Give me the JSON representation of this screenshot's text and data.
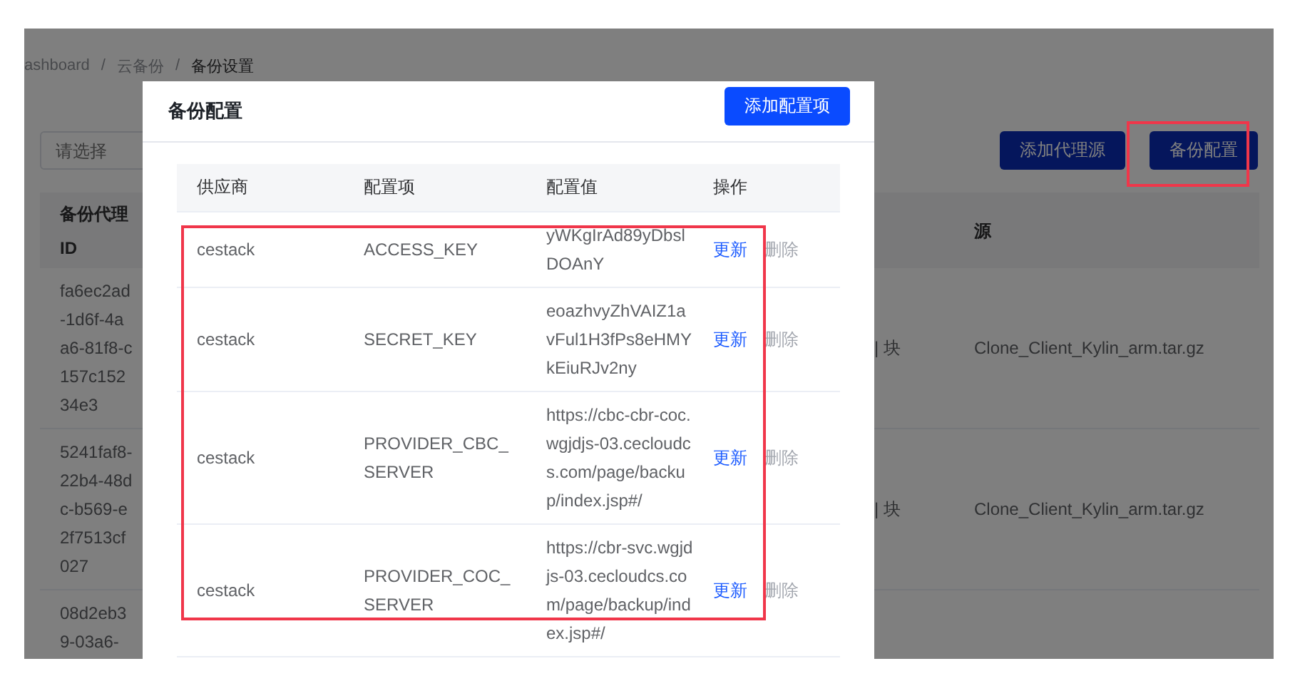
{
  "breadcrumb": [
    "ashboard",
    "云备份",
    "备份设置"
  ],
  "breadcrumb_separator": "/",
  "filter": {
    "placeholder": "请选择"
  },
  "toolbar_buttons": [
    "添加代理源",
    "备份配置"
  ],
  "agent_table": {
    "columns": [
      "备份代理 ID",
      "源"
    ],
    "rows": [
      {
        "id": "fa6ec2ad-1d6f-4aa6-81f8-c157c15234e3",
        "column_3": "| 块",
        "source": "Clone_Client_Kylin_arm.tar.gz"
      },
      {
        "id": "5241faf8-22b4-48dc-b569-e2f7513cf027",
        "column_3": "| 块",
        "source": "Clone_Client_Kylin_arm.tar.gz"
      },
      {
        "id": "08d2eb39-03a6-",
        "column_3": "",
        "source": ""
      }
    ]
  },
  "dialog": {
    "title": "备份配置",
    "add_button": "添加配置项",
    "columns": [
      "供应商",
      "配置项",
      "配置值",
      "操作"
    ],
    "rows": [
      {
        "provider": "cestack",
        "item": "ACCESS_KEY",
        "value": "yWKgIrAd89yDbslDOAnY",
        "actions": [
          {
            "label": "更新",
            "disabled": false
          },
          {
            "label": "删除",
            "disabled": true
          }
        ]
      },
      {
        "provider": "cestack",
        "item": "SECRET_KEY",
        "value": "eoazhvyZhVAIZ1avFul1H3fPs8eHMYkEiuRJv2ny",
        "actions": [
          {
            "label": "更新",
            "disabled": false
          },
          {
            "label": "删除",
            "disabled": true
          }
        ]
      },
      {
        "provider": "cestack",
        "item": "PROVIDER_CBC_SERVER",
        "value": "https://cbc-cbr-coc.wgjdjs-03.cecloudcs.com/page/backup/index.jsp#/",
        "actions": [
          {
            "label": "更新",
            "disabled": false
          },
          {
            "label": "删除",
            "disabled": true
          }
        ]
      },
      {
        "provider": "cestack",
        "item": "PROVIDER_COC_SERVER",
        "value": "https://cbr-svc.wgjdjs-03.cecloudcs.com/page/backup/index.jsp#/",
        "actions": [
          {
            "label": "更新",
            "disabled": false
          },
          {
            "label": "删除",
            "disabled": true
          }
        ]
      }
    ]
  }
}
